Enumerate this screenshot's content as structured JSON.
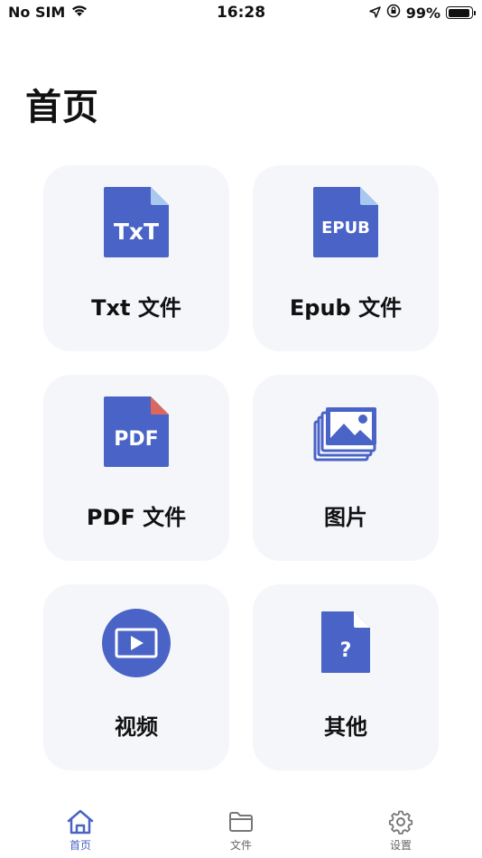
{
  "status_bar": {
    "carrier": "No SIM",
    "time": "16:28",
    "battery": "99%"
  },
  "page": {
    "title": "首页"
  },
  "cards": [
    {
      "label": "Txt 文件",
      "icon": "txt-file-icon",
      "icon_text": "TxT"
    },
    {
      "label": "Epub 文件",
      "icon": "epub-file-icon",
      "icon_text": "EPUB"
    },
    {
      "label": "PDF 文件",
      "icon": "pdf-file-icon",
      "icon_text": "PDF"
    },
    {
      "label": "图片",
      "icon": "images-icon"
    },
    {
      "label": "视频",
      "icon": "video-play-icon"
    },
    {
      "label": "其他",
      "icon": "unknown-file-icon",
      "icon_text": "?"
    }
  ],
  "tab_bar": {
    "items": [
      {
        "label": "首页",
        "icon": "home-icon",
        "active": true
      },
      {
        "label": "文件",
        "icon": "folder-icon",
        "active": false
      },
      {
        "label": "设置",
        "icon": "gear-icon",
        "active": false
      }
    ]
  },
  "colors": {
    "accent": "#4a63c6",
    "card_bg": "#f4f6fa",
    "file_corner": "#a9c8f0",
    "pdf_corner": "#d9685e"
  }
}
